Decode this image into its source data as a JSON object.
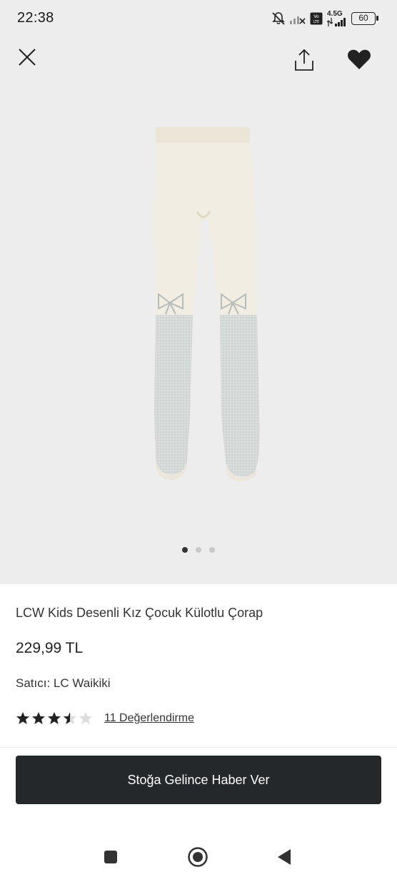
{
  "status_bar": {
    "time": "22:38",
    "network": "4.5G",
    "volte": "Vo LTE",
    "battery": "60",
    "icons": [
      "mute-bell-icon",
      "signal-off-icon",
      "volte-icon",
      "signal-icon",
      "battery-icon"
    ]
  },
  "gallery": {
    "close_icon": "close-icon",
    "share_icon": "share-icon",
    "favorite_icon": "heart-icon",
    "page_count": 3,
    "active_index": 0,
    "colors": {
      "background": "#ededed",
      "dot_active": "#333333",
      "dot_inactive": "#c9c9c9"
    }
  },
  "product": {
    "title": "LCW Kids Desenli Kız Çocuk Külotlu Çorap",
    "price": "229,99 TL",
    "seller": "Satıcı: LC Waikiki",
    "rating": 3.5,
    "rating_max": 5,
    "reviews_link": "11 Değerlendirme"
  },
  "cta": {
    "label": "Stoğa Gelince Haber Ver",
    "color": "#25282b"
  },
  "navigation": {
    "icons": [
      "recent-apps-icon",
      "home-icon",
      "back-icon"
    ]
  }
}
